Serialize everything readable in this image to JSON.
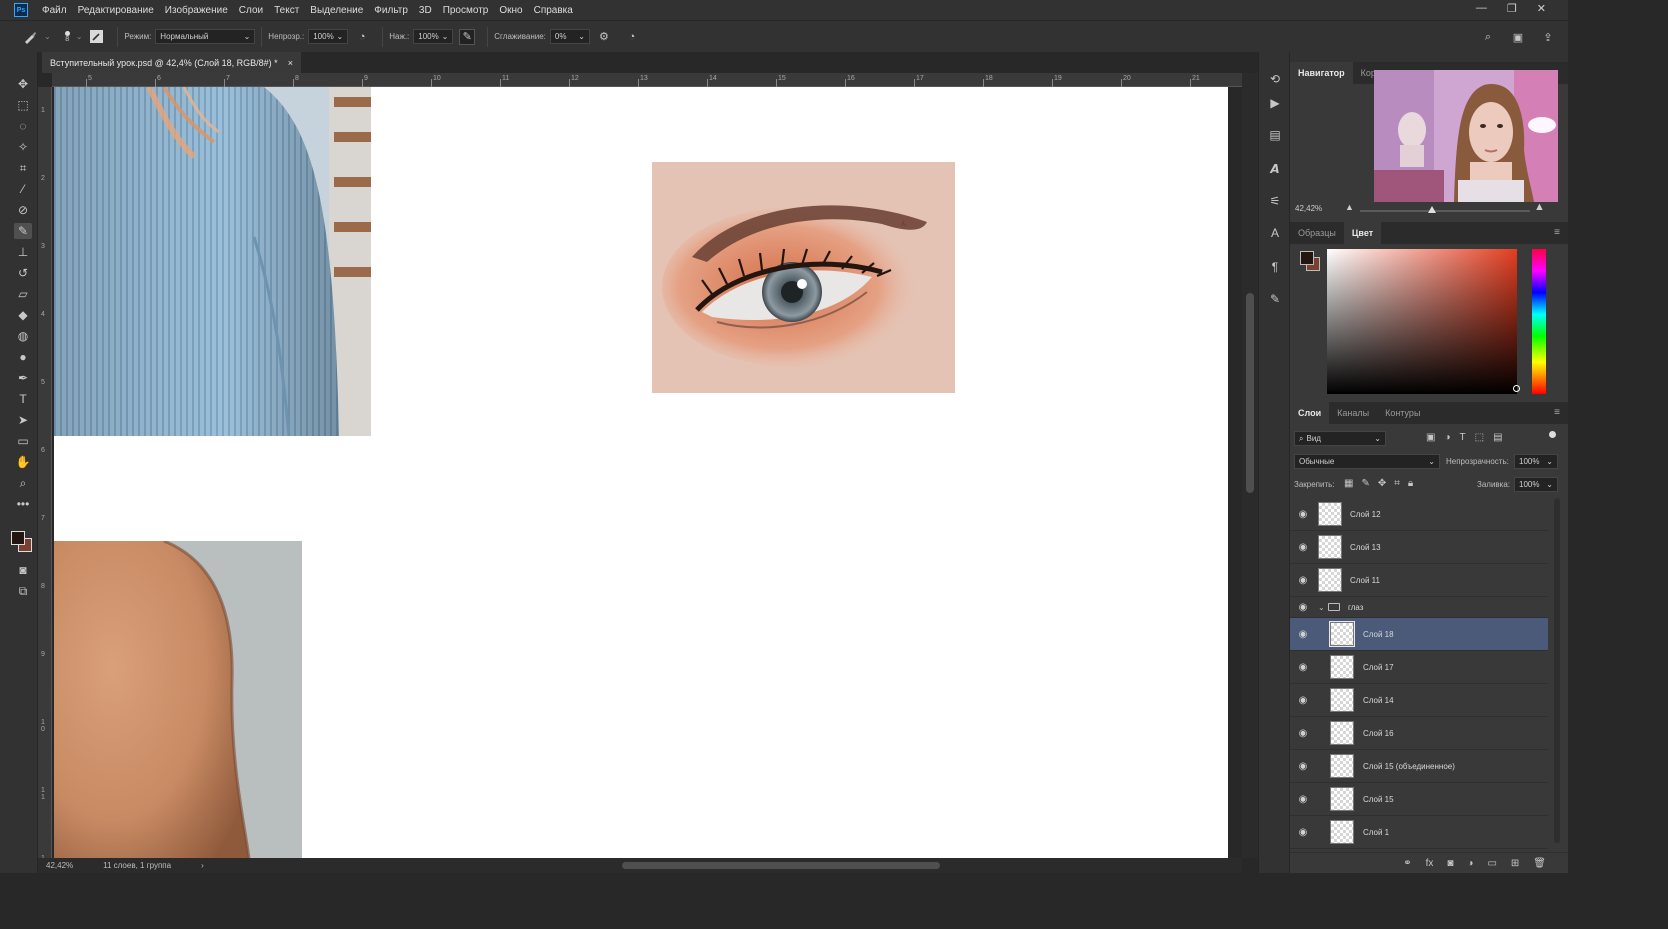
{
  "app": {
    "logo_text": "Ps"
  },
  "menu": [
    "Файл",
    "Редактирование",
    "Изображение",
    "Слои",
    "Текст",
    "Выделение",
    "Фильтр",
    "3D",
    "Просмотр",
    "Окно",
    "Справка"
  ],
  "window_controls": {
    "minimize": "—",
    "restore": "❐",
    "close": "✕"
  },
  "options_bar": {
    "brush_size": "8",
    "mode_label": "Режим:",
    "mode_value": "Нормальный",
    "opacity_label": "Непрозр.:",
    "opacity_value": "100%",
    "pressure_label": "Наж.:",
    "pressure_value": "100%",
    "smoothing_label": "Сглаживание:",
    "smoothing_value": "0%"
  },
  "document": {
    "tab_title": "Вступительный урок.psd @ 42,4% (Слой 18, RGB/8#) *",
    "close_glyph": "×",
    "ruler_top_ticks": [
      "5",
      "6",
      "7",
      "8",
      "9",
      "10",
      "11",
      "12",
      "13",
      "14",
      "15",
      "16",
      "17",
      "18",
      "19",
      "20",
      "21"
    ],
    "ruler_left_ticks": [
      "1",
      "2",
      "3",
      "4",
      "5",
      "6",
      "7",
      "8",
      "9",
      "1\n0",
      "1\n1",
      "1\n2"
    ]
  },
  "status_bar": {
    "zoom": "42,42%",
    "info": "11 слоев, 1 группа",
    "arrow": "›"
  },
  "navigator": {
    "tab_navigator": "Навигатор",
    "tab_correction": "Корр",
    "zoom": "42,42%",
    "zoom_level": 0.4
  },
  "color_panel": {
    "tab_swatches": "Образцы",
    "tab_color": "Цвет",
    "foreground_color": "#231510",
    "background_color": "#7a4133"
  },
  "layers_panel": {
    "tab_layers": "Слои",
    "tab_channels": "Каналы",
    "tab_paths": "Контуры",
    "filter_label": "Вид",
    "blend_mode": "Обычные",
    "opacity_label": "Непрозрачность:",
    "opacity_value": "100%",
    "lock_label": "Закрепить:",
    "fill_label": "Заливка:",
    "fill_value": "100%",
    "layers": [
      {
        "name": "Слой 12",
        "selected": false,
        "indent": false
      },
      {
        "name": "Слой 13",
        "selected": false,
        "indent": false
      },
      {
        "name": "Слой 11",
        "selected": false,
        "indent": false
      },
      {
        "name": "глаз",
        "selected": false,
        "indent": false,
        "group": true
      },
      {
        "name": "Слой 18",
        "selected": true,
        "indent": true
      },
      {
        "name": "Слой 17",
        "selected": false,
        "indent": true
      },
      {
        "name": "Слой 14",
        "selected": false,
        "indent": true
      },
      {
        "name": "Слой 16",
        "selected": false,
        "indent": true
      },
      {
        "name": "Слой 15 (объединенное)",
        "selected": false,
        "indent": true
      },
      {
        "name": "Слой 15",
        "selected": false,
        "indent": true
      },
      {
        "name": "Слой 1",
        "selected": false,
        "indent": true
      }
    ]
  },
  "colors": {
    "selection": "#4a5a78",
    "accent": "#31a8ff"
  }
}
